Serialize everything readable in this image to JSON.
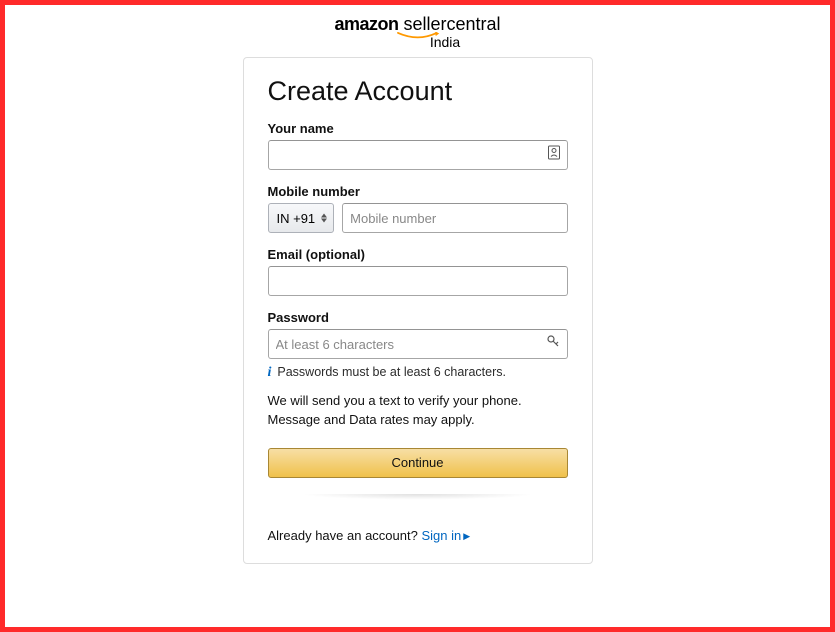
{
  "logo": {
    "amazon": "amazon",
    "seller": "seller",
    "central": "central",
    "region": "India"
  },
  "form": {
    "title": "Create Account",
    "name": {
      "label": "Your name",
      "value": ""
    },
    "mobile": {
      "label": "Mobile number",
      "country_code": "IN +91",
      "placeholder": "Mobile number",
      "value": ""
    },
    "email": {
      "label": "Email (optional)",
      "value": ""
    },
    "password": {
      "label": "Password",
      "placeholder": "At least 6 characters",
      "value": "",
      "hint": "Passwords must be at least 6 characters."
    },
    "disclosure_line1": "We will send you a text to verify your phone.",
    "disclosure_line2": "Message and Data rates may apply.",
    "continue": "Continue"
  },
  "signin": {
    "prompt": "Already have an account? ",
    "link": "Sign in"
  }
}
